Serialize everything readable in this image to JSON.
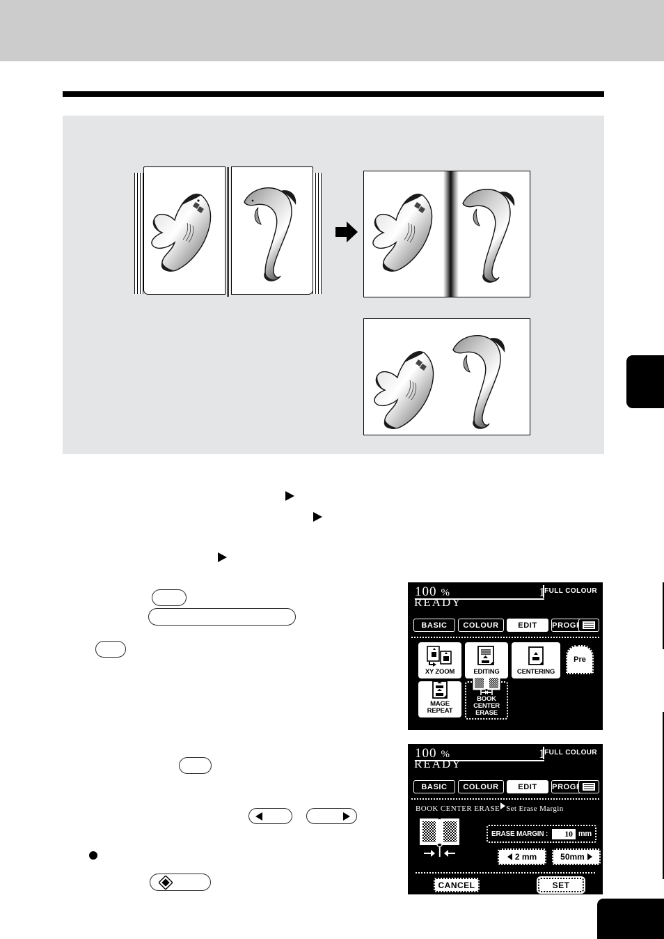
{
  "illustration": {
    "caption_book": "open-book-original",
    "caption_result_shadow": "copy-with-center-shadow",
    "caption_result_erased": "copy-with-center-erased",
    "flow_arrow": "right-arrow"
  },
  "instructions": {
    "markers": [
      "triangle-marker-1",
      "triangle-marker-2",
      "triangle-marker-3"
    ],
    "bullet": "round-bullet",
    "redacted_note": ""
  },
  "lcd_edit": {
    "zoom": "100",
    "percent": "%",
    "copies": "1",
    "colour_mode": "FULL COLOUR",
    "status": "READY",
    "tabs": [
      {
        "label": "BASIC",
        "active": false
      },
      {
        "label": "COLOUR",
        "active": false
      },
      {
        "label": "EDIT",
        "active": true
      },
      {
        "label": "PROGRAM",
        "active": false
      }
    ],
    "tab_icon": "settings-list-icon",
    "functions": [
      {
        "label": "XY ZOOM",
        "icon": "xy-zoom-icon",
        "selected": false
      },
      {
        "label": "EDITING",
        "icon": "editing-icon",
        "selected": false
      },
      {
        "label": "CENTERING",
        "icon": "centering-icon",
        "selected": false
      },
      {
        "label": "MAGE REPEAT",
        "icon": "image-repeat-icon",
        "selected": false
      },
      {
        "label": "BOOK CENTER\nERASE",
        "icon": "book-center-erase-icon",
        "selected": true
      }
    ],
    "function_labels": {
      "xy_zoom": "XY ZOOM",
      "editing": "EDITING",
      "centering": "CENTERING",
      "image_repeat": "MAGE REPEAT",
      "book_center_erase_line1": "BOOK CENTER",
      "book_center_erase_line2": "ERASE"
    },
    "preset_tab_label": "Pre"
  },
  "lcd_margin": {
    "zoom": "100",
    "percent": "%",
    "copies": "1",
    "colour_mode": "FULL COLOUR",
    "status": "READY",
    "tabs": [
      {
        "label": "BASIC",
        "active": false
      },
      {
        "label": "COLOUR",
        "active": false
      },
      {
        "label": "EDIT",
        "active": true
      },
      {
        "label": "PROGRAM",
        "active": false
      }
    ],
    "tab_icon": "settings-list-icon",
    "breadcrumb_parent": "BOOK CENTER ERASE",
    "breadcrumb_child": "Set Erase Margin",
    "margin_field_label": "ERASE MARGIN :",
    "margin_value": "10",
    "margin_unit": "mm",
    "decrease_button": "2 mm",
    "increase_button": "50mm",
    "cancel_button": "CANCEL",
    "set_button": "SET",
    "book_icon": "book-erase-margin-icon"
  },
  "colors": {
    "header_band": "#cccccc",
    "illustration_bg": "#e4e5e7",
    "lcd_bg": "#000000",
    "lcd_fg": "#ffffff",
    "rule": "#000000"
  }
}
